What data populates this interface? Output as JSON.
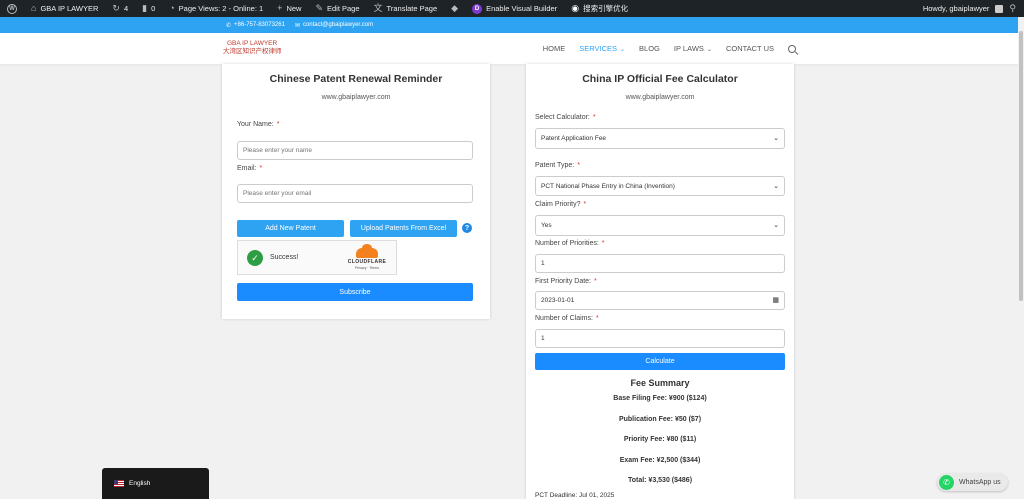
{
  "admin_bar": {
    "site_name": "GBA IP LAWYER",
    "updates_count": "4",
    "comments_count": "0",
    "page_views": "Page Views: 2 - Online: 1",
    "new_label": "New",
    "edit_page": "Edit Page",
    "translate_page": "Translate Page",
    "visual_builder": "Enable Visual Builder",
    "seo_label": "搜索引擎优化",
    "howdy": "Howdy, gbaiplawyer"
  },
  "topbar": {
    "phone": "+86-757-83073261",
    "email": "contact@gbaiplawyer.com"
  },
  "header": {
    "logo_line1": "GBA IP LAWYER",
    "logo_line2": "大湾区知识产权律师",
    "nav": [
      {
        "label": "HOME",
        "active": false
      },
      {
        "label": "SERVICES",
        "active": true,
        "dropdown": true
      },
      {
        "label": "BLOG",
        "active": false
      },
      {
        "label": "IP LAWS",
        "active": false,
        "dropdown": true
      },
      {
        "label": "CONTACT US",
        "active": false
      }
    ]
  },
  "reminder": {
    "title": "Chinese Patent Renewal Reminder",
    "site": "www.gbaiplawyer.com",
    "name_label": "Your Name:",
    "name_placeholder": "Please enter your name",
    "email_label": "Email:",
    "email_placeholder": "Please enter your email",
    "add_button": "Add New Patent",
    "upload_button": "Upload Patents From Excel",
    "help": "?",
    "captcha_status": "Success!",
    "captcha_brand": "CLOUDFLARE",
    "captcha_links": "Privacy  ·  Terms",
    "subscribe_button": "Subscribe"
  },
  "calculator": {
    "title": "China IP Official Fee Calculator",
    "site": "www.gbaiplawyer.com",
    "select_calc_label": "Select Calculator:",
    "select_calc_value": "Patent Application Fee",
    "patent_type_label": "Patent Type:",
    "patent_type_value": "PCT National Phase Entry in China (Invention)",
    "claim_priority_label": "Claim Priority?",
    "claim_priority_value": "Yes",
    "num_priorities_label": "Number of Priorities:",
    "num_priorities_value": "1",
    "first_priority_label": "First Priority Date:",
    "first_priority_value": "2023-01-01",
    "num_claims_label": "Number of Claims:",
    "num_claims_value": "1",
    "calculate_button": "Calculate",
    "summary_title": "Fee Summary",
    "base_fee": "Base Filing Fee: ¥900 ($124)",
    "publication_fee": "Publication Fee: ¥50 ($7)",
    "priority_fee": "Priority Fee: ¥80 ($11)",
    "exam_fee": "Exam Fee: ¥2,500 ($344)",
    "total": "Total: ¥3,530 ($486)",
    "deadline": "PCT Deadline: Jul 01, 2025"
  },
  "language": {
    "label": "English"
  },
  "whatsapp": {
    "label": "WhatsApp us"
  },
  "colors": {
    "accent": "#2ea3f2",
    "admin_bg": "#1d2327",
    "success": "#2e9e44"
  }
}
